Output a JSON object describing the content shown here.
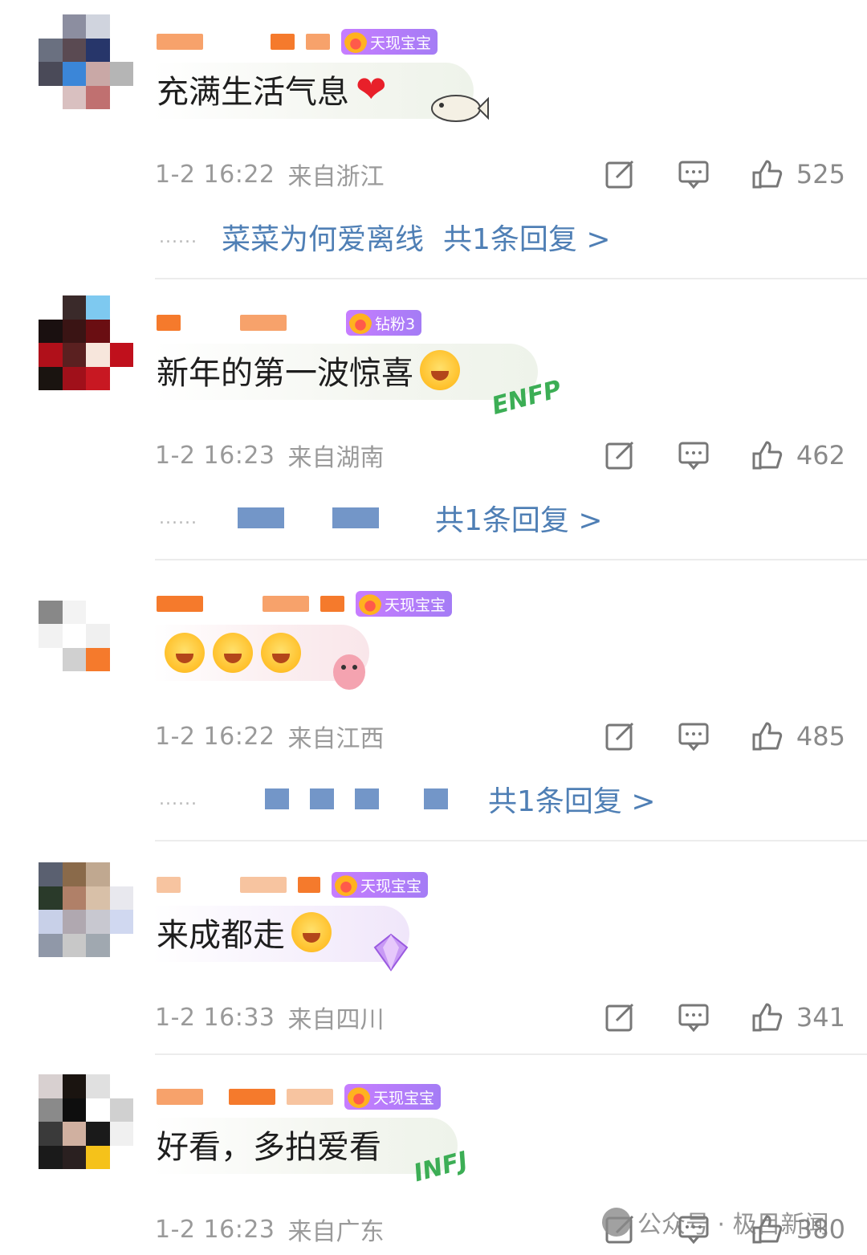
{
  "comments": [
    {
      "badge": "天现宝宝",
      "text": "充满生活气息",
      "time": "1-2 16:22",
      "location": "来自浙江",
      "likes": "525",
      "reply_user": "菜菜为何爱离线",
      "reply_total": "共1条回复 >"
    },
    {
      "badge": "钻粉3",
      "text": "新年的第一波惊喜",
      "deco": "ENFP",
      "time": "1-2 16:23",
      "location": "来自湖南",
      "likes": "462",
      "reply_total": "共1条回复 >"
    },
    {
      "badge": "天现宝宝",
      "text": "",
      "time": "1-2 16:22",
      "location": "来自江西",
      "likes": "485",
      "reply_total": "共1条回复 >"
    },
    {
      "badge": "天现宝宝",
      "text": "来成都走",
      "time": "1-2 16:33",
      "location": "来自四川",
      "likes": "341"
    },
    {
      "badge": "天现宝宝",
      "text": "好看，多拍爱看",
      "deco": "INFJ",
      "time": "1-2 16:23",
      "location": "来自广东",
      "likes": "380"
    }
  ],
  "reply_dots": "......",
  "watermark": {
    "text": "公众号 · 极目新闻"
  },
  "colors": {
    "link_blue": "#4f7fb5",
    "meta_gray": "#9a9a9a",
    "badge_purple": "#b07df5",
    "name_orange": "#f57a2c",
    "heart_red": "#e8202a"
  }
}
